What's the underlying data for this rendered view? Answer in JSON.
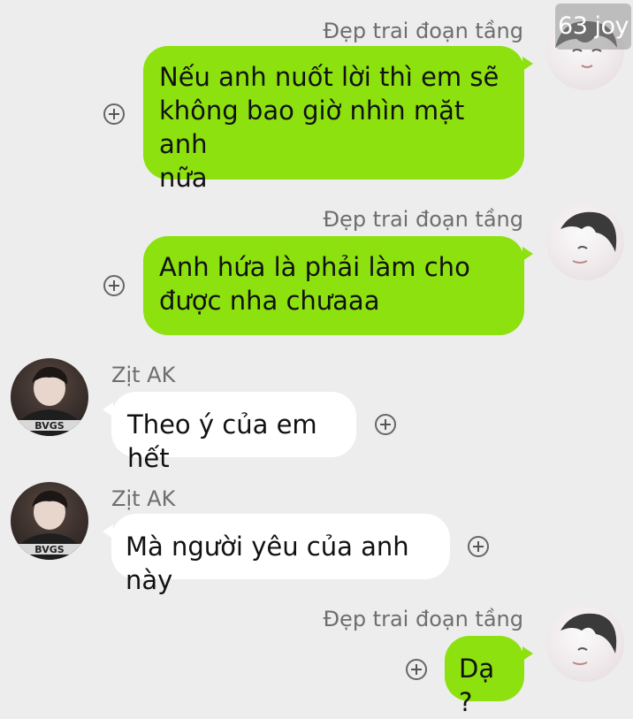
{
  "watermark": "63 joy",
  "messages": [
    {
      "side": "right",
      "sender": "Đẹp trai đoạn tầng",
      "lines": [
        "Nếu anh nuốt lời thì em sẽ",
        "không bao giờ nhìn mặt anh",
        "nữa"
      ]
    },
    {
      "side": "right",
      "sender": "Đẹp trai đoạn tầng",
      "lines": [
        "Anh hứa là phải làm cho",
        "được nha chưaaa"
      ]
    },
    {
      "side": "left",
      "sender": "Zịt AK",
      "lines": [
        "Theo ý của em hết"
      ],
      "avatar_text": "BVGS"
    },
    {
      "side": "left",
      "sender": "Zịt AK",
      "lines": [
        "Mà người yêu của anh này"
      ],
      "avatar_text": "BVGS"
    },
    {
      "side": "right",
      "sender": "Đẹp trai đoạn tầng",
      "lines": [
        "Dạ ?"
      ]
    }
  ],
  "colors": {
    "background": "#ededed",
    "own_bubble": "#8de10f",
    "other_bubble": "#ffffff",
    "sender_name": "#6e6e6e"
  }
}
